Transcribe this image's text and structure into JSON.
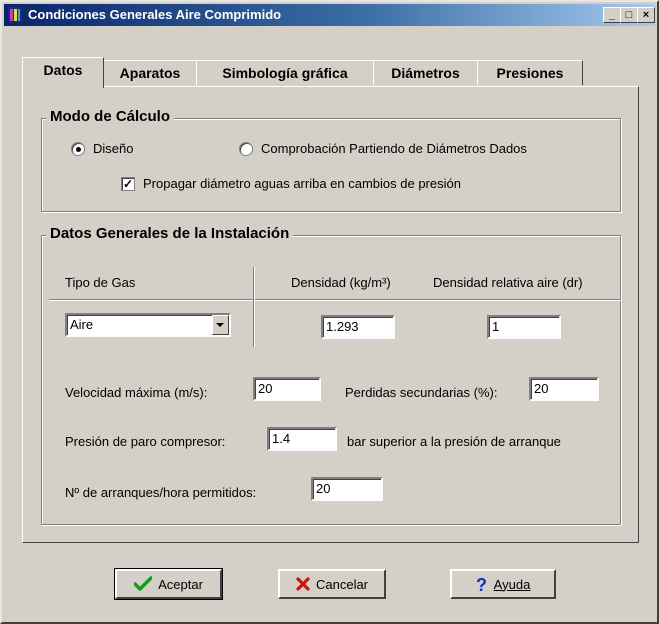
{
  "window": {
    "title": "Condiciones  Generales Aire Comprimido",
    "controls": {
      "minimize": "_",
      "maximize": "□",
      "close": "×"
    }
  },
  "tabs": [
    {
      "label": "Datos",
      "active": true
    },
    {
      "label": "Aparatos",
      "active": false
    },
    {
      "label": "Simbología gráfica",
      "active": false
    },
    {
      "label": "Diámetros",
      "active": false
    },
    {
      "label": "Presiones",
      "active": false
    }
  ],
  "modo_calculo": {
    "title": "Modo de Cálculo",
    "options": [
      {
        "label": "Diseño",
        "selected": true
      },
      {
        "label": "Comprobación Partiendo de Diámetros Dados",
        "selected": false
      }
    ],
    "propagar": {
      "label": "Propagar diámetro aguas arriba en cambios de presión",
      "checked": true
    }
  },
  "datos_generales": {
    "title": "Datos Generales de la Instalación",
    "headers": {
      "tipo_gas": "Tipo de Gas",
      "densidad": "Densidad (kg/m³)",
      "densidad_relativa": "Densidad relativa aire (dr)"
    },
    "tipo_gas_value": "Aire",
    "densidad_value": "1.293",
    "densidad_relativa_value": "1",
    "velocidad_label": "Velocidad máxima (m/s):",
    "velocidad_value": "20",
    "perdidas_label": "Perdidas secundarias (%):",
    "perdidas_value": "20",
    "presion_label": "Presión de paro compresor:",
    "presion_value": "1.4",
    "presion_suffix": "bar superior a la presión de arranque",
    "arranques_label": "Nº de arranques/hora permitidos:",
    "arranques_value": "20"
  },
  "buttons": {
    "aceptar": "Aceptar",
    "cancelar": "Cancelar",
    "ayuda": "Ayuda"
  },
  "icons": {
    "aceptar": "checkmark-icon",
    "cancelar": "red-x-icon",
    "ayuda": "question-mark-icon"
  },
  "colors": {
    "titlebar_start": "#0a246a",
    "titlebar_end": "#a6caf0",
    "face": "#d4d0c8",
    "check_green": "#1a9a1a",
    "cancel_red": "#cc1111",
    "help_blue": "#1030c0"
  }
}
